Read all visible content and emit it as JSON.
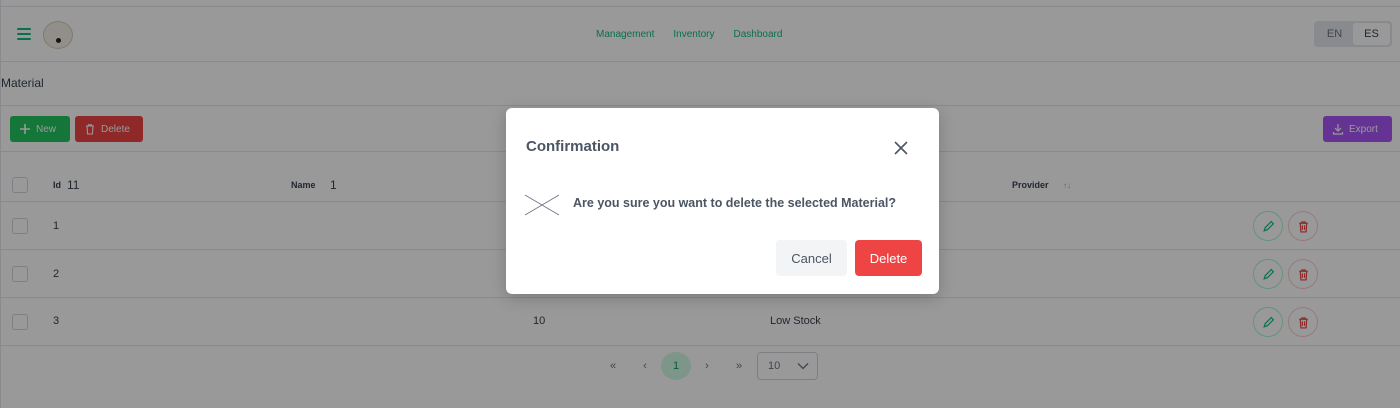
{
  "header": {
    "nav": [
      "Management",
      "Inventory",
      "Dashboard"
    ],
    "lang_options": [
      "EN",
      "ES"
    ],
    "lang_selected": "ES"
  },
  "page": {
    "title": "Material"
  },
  "toolbar": {
    "new_label": "New",
    "delete_label": "Delete",
    "export_label": "Export"
  },
  "table": {
    "columns": {
      "id": {
        "label": "Id",
        "badge": "11"
      },
      "name": {
        "label": "Name",
        "badge": "1"
      },
      "provider": {
        "label": "Provider"
      }
    },
    "rows": [
      {
        "id": "1",
        "quantity": "",
        "status": ""
      },
      {
        "id": "2",
        "quantity": "",
        "status": ""
      },
      {
        "id": "3",
        "quantity": "10",
        "status": "Low Stock"
      }
    ]
  },
  "paginator": {
    "first": "«",
    "prev": "‹",
    "current_page": "1",
    "next": "›",
    "last": "»",
    "rows_per_page": "10"
  },
  "dialog": {
    "title": "Confirmation",
    "message": "Are you sure you want to delete the selected Material?",
    "cancel_label": "Cancel",
    "delete_label": "Delete"
  },
  "colors": {
    "primary": "#10b981",
    "danger": "#ef4444",
    "export": "#a855f7",
    "new": "#22c55e"
  }
}
